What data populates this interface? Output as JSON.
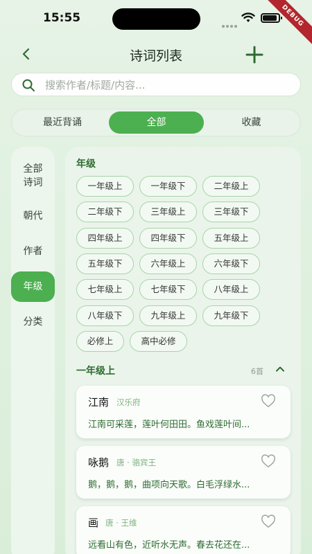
{
  "status": {
    "time": "15:55",
    "debug": "DEBUG"
  },
  "header": {
    "title": "诗词列表"
  },
  "search": {
    "placeholder": "搜索作者/标题/内容..."
  },
  "tabs": [
    "最近背诵",
    "全部",
    "收藏"
  ],
  "sidebar": {
    "items": [
      "全部\n诗词",
      "朝代",
      "作者",
      "年级",
      "分类"
    ]
  },
  "grade_section": {
    "heading": "年级",
    "chips": [
      "一年级上",
      "一年级下",
      "二年级上",
      "二年级下",
      "三年级上",
      "三年级下",
      "四年级上",
      "四年级下",
      "五年级上",
      "五年级下",
      "六年级上",
      "六年级下",
      "七年级上",
      "七年级下",
      "八年级上",
      "八年级下",
      "九年级上",
      "九年级下",
      "必修上",
      "高中必修"
    ]
  },
  "list_section": {
    "title": "一年级上",
    "count": "6首"
  },
  "poems": [
    {
      "title": "江南",
      "meta": "汉乐府",
      "body": "江南可采莲，莲叶何田田。鱼戏莲叶间..."
    },
    {
      "title": "咏鹅",
      "meta": "唐 · 骆宾王",
      "body": "鹅，鹅，鹅，曲项向天歌。白毛浮绿水..."
    },
    {
      "title": "画",
      "meta": "唐 · 王维",
      "body": "远看山有色，近听水无声。春去花还在..."
    }
  ],
  "colors": {
    "accent": "#4caf50",
    "accent_dark": "#2e6b30",
    "background": "#e6f3e6"
  }
}
